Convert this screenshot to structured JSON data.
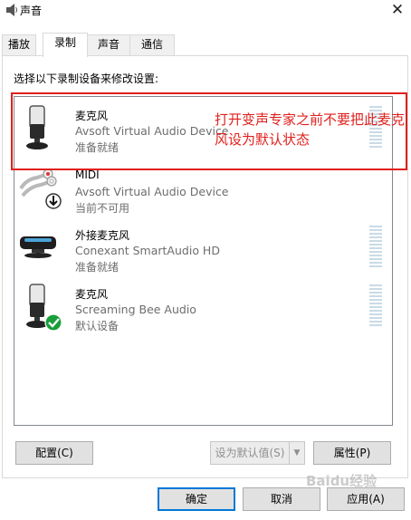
{
  "window": {
    "title": "声音",
    "close_glyph": "✕"
  },
  "tabs": [
    {
      "label": "播放",
      "active": false
    },
    {
      "label": "录制",
      "active": true
    },
    {
      "label": "声音",
      "active": false
    },
    {
      "label": "通信",
      "active": false
    }
  ],
  "panel": {
    "instruction": "选择以下录制设备来修改设置:"
  },
  "devices": [
    {
      "name": "麦克风",
      "driver": "Avsoft Virtual Audio Device",
      "status": "准备就绪",
      "icon": "microphone-icon",
      "badge": null,
      "meter": true
    },
    {
      "name": "MIDI",
      "driver": "Avsoft Virtual Audio Device",
      "status": "当前不可用",
      "icon": "rca-cable-icon",
      "badge": "down-arrow-badge",
      "meter": false
    },
    {
      "name": "外接麦克风",
      "driver": "Conexant SmartAudio HD",
      "status": "准备就绪",
      "icon": "external-microphone-icon",
      "badge": null,
      "meter": true
    },
    {
      "name": "麦克风",
      "driver": "Screaming Bee Audio",
      "status": "默认设备",
      "icon": "microphone-icon",
      "badge": "default-check-badge",
      "meter": true
    }
  ],
  "annotation": {
    "text": "打开变声专家之前不要把此麦克风设为默认状态",
    "color": "#e0201d"
  },
  "buttons": {
    "configure": "配置(C)",
    "set_default": "设为默认值(S)",
    "properties": "属性(P)",
    "ok": "确定",
    "cancel": "取消",
    "apply": "应用(A)"
  },
  "watermark": "Baidu经验",
  "colors": {
    "accent": "#0078d7",
    "check_green": "#1a9e3a"
  }
}
